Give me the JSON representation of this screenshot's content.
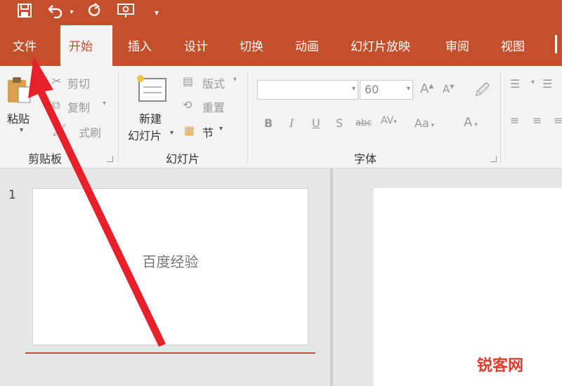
{
  "ribbon_tabs": [
    "文件",
    "开始",
    "插入",
    "设计",
    "切换",
    "动画",
    "幻灯片放映",
    "审阅",
    "视图"
  ],
  "active_tab": "开始",
  "clipboard": {
    "paste_label": "粘贴",
    "cut_label": "剪切",
    "copy_label": "复制",
    "format_painter_label": "式刷",
    "group_label": "剪贴板"
  },
  "slides_group": {
    "new_slide_line1": "新建",
    "new_slide_line2": "幻灯片",
    "layout_label": "版式",
    "reset_label": "重置",
    "section_label": "节",
    "group_label": "幻灯片"
  },
  "font_group": {
    "font_name": "",
    "font_size": "60",
    "clear_format_hint": "Aa",
    "group_label": "字体"
  },
  "slide_thumbnail": {
    "number": "1",
    "text": "百度经验"
  },
  "watermark": "锐客网",
  "colors": {
    "accent": "#c4502b",
    "arrow": "#e8202a",
    "ribbon_bg": "#f3f3f3"
  }
}
